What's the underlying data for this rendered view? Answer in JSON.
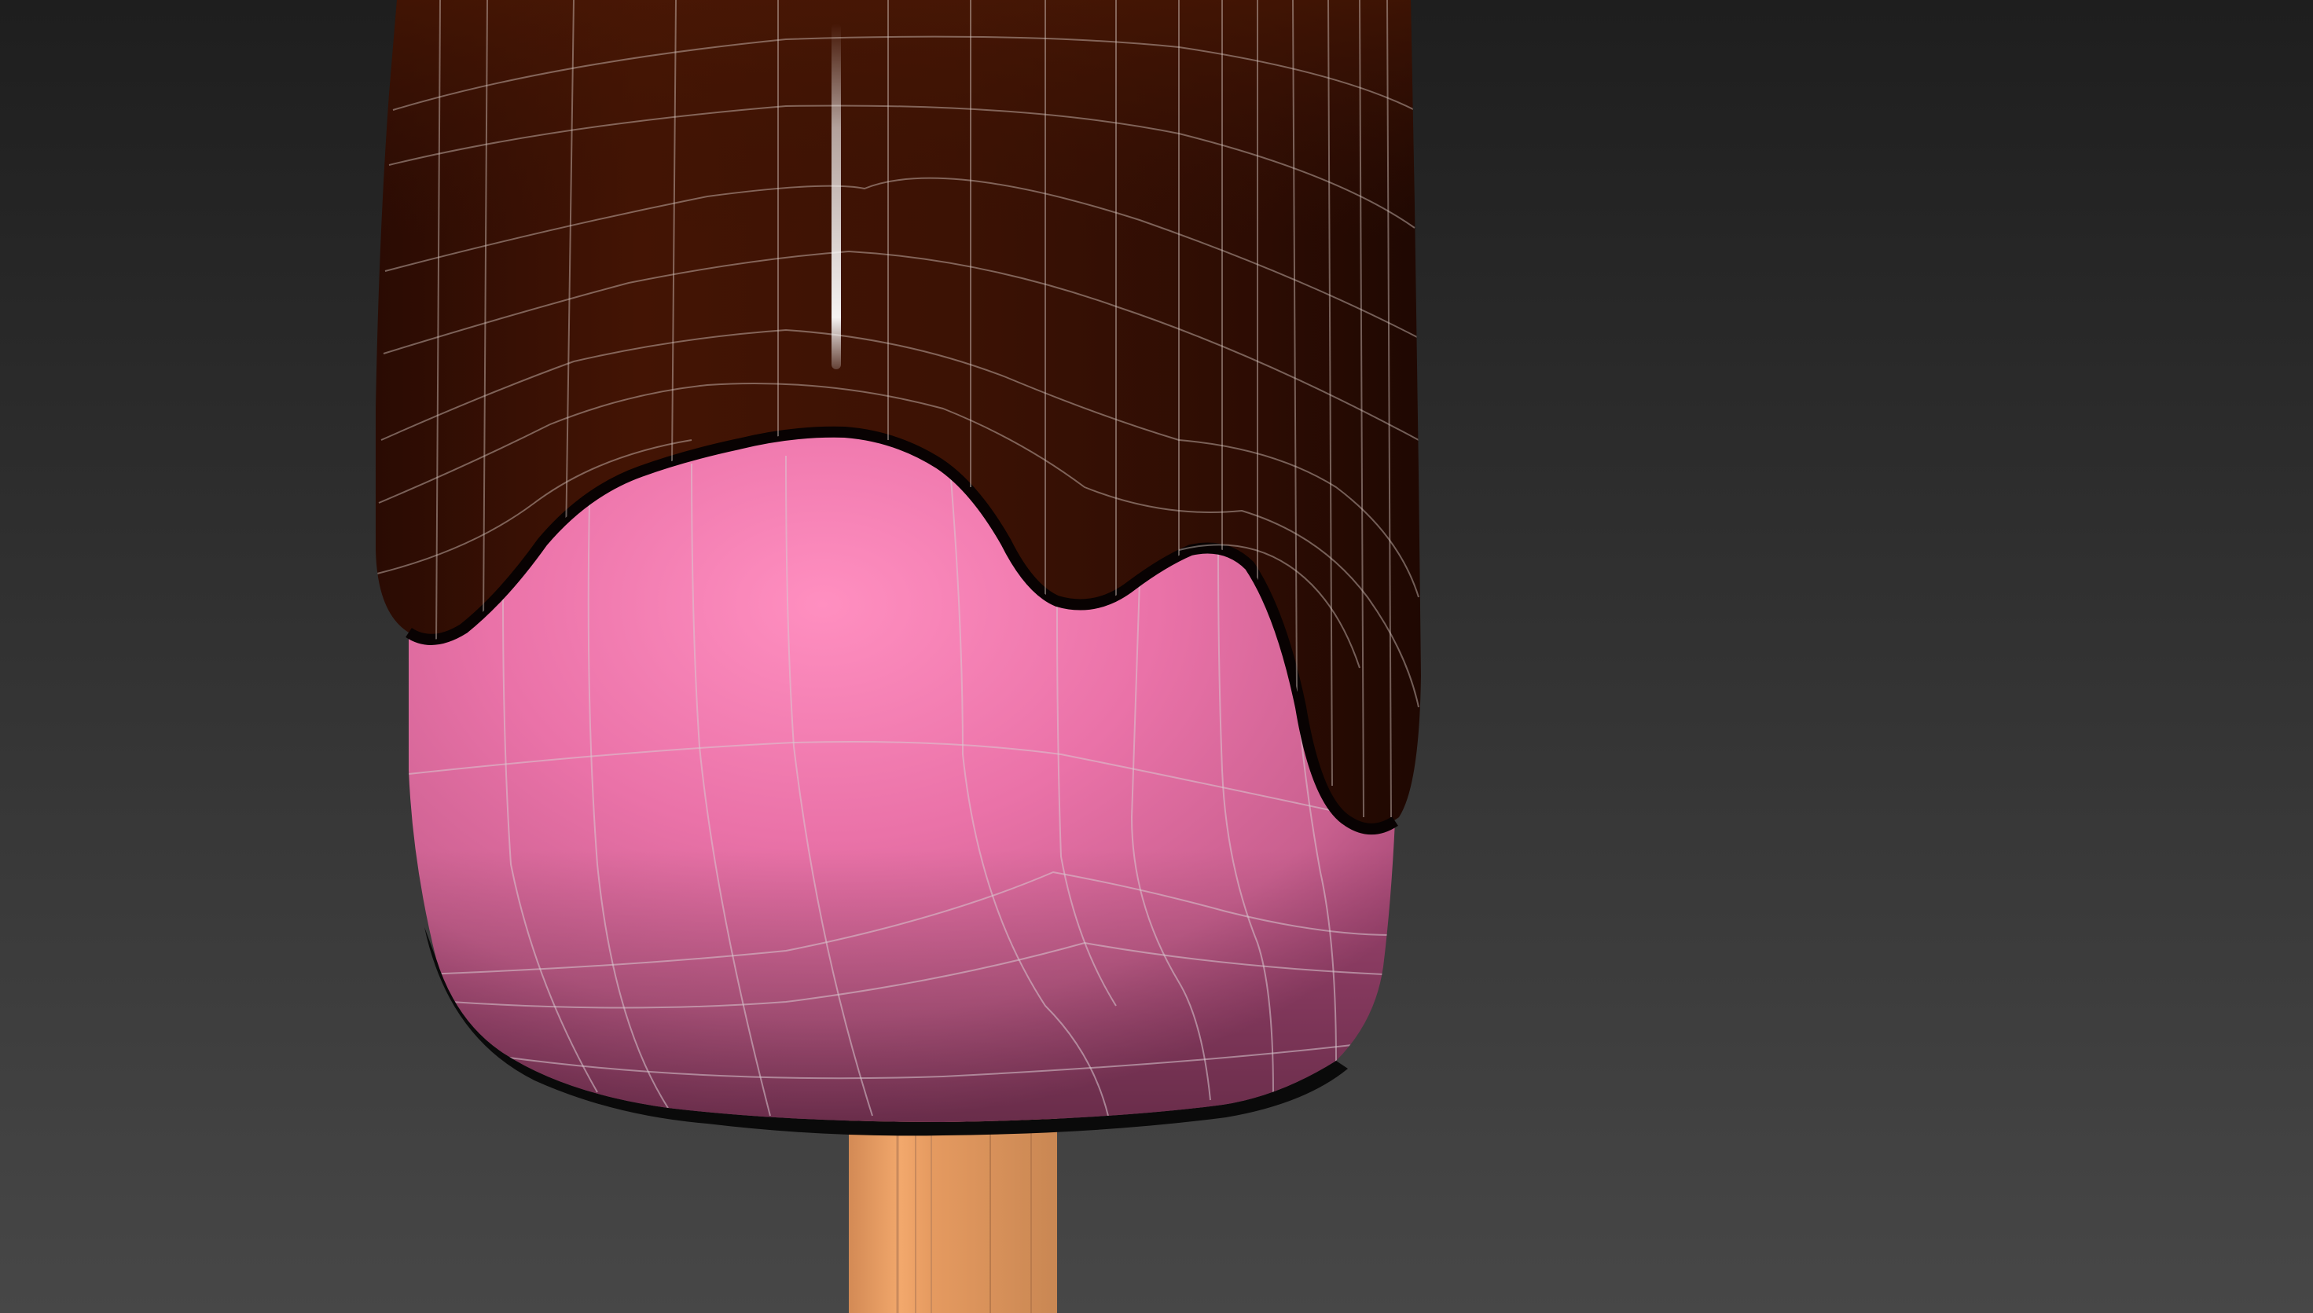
{
  "viewport": {
    "background_top": "#1f1f1f",
    "background_bottom": "#474747"
  },
  "model": {
    "name_icon": "popsicle-icon",
    "chocolate_color": "#3a1205",
    "chocolate_highlight": "#5a1e08",
    "pink_color": "#f07fb0",
    "pink_shadow": "#c85c8f",
    "stick_color": "#d8935c",
    "stick_highlight": "#f2a86c",
    "wireframe_color": "#cfcfcf"
  }
}
